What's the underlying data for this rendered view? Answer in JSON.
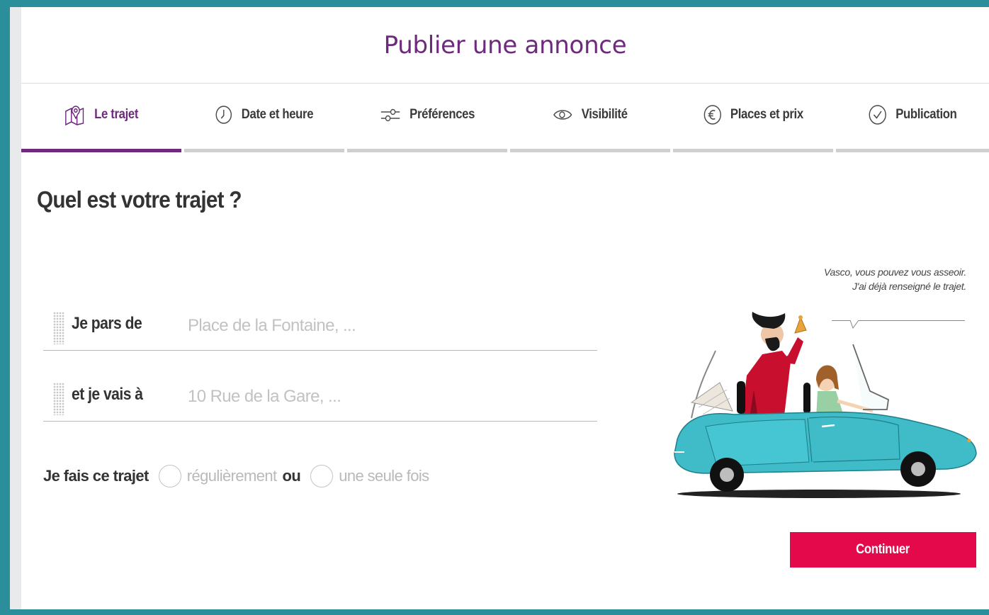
{
  "header": {
    "title": "Publier une annonce"
  },
  "steps": [
    {
      "label": "Le trajet",
      "icon": "map-pin-icon",
      "active": true
    },
    {
      "label": "Date et heure",
      "icon": "clock-icon",
      "active": false
    },
    {
      "label": "Préférences",
      "icon": "sliders-icon",
      "active": false
    },
    {
      "label": "Visibilité",
      "icon": "eye-icon",
      "active": false
    },
    {
      "label": "Places et prix",
      "icon": "euro-icon",
      "active": false
    },
    {
      "label": "Publication",
      "icon": "check-circle-icon",
      "active": false
    }
  ],
  "question": "Quel est votre trajet ?",
  "from": {
    "label": "Je pars de",
    "placeholder": "Place de la Fontaine, ...",
    "value": ""
  },
  "to": {
    "label": "et je vais à",
    "placeholder": "10 Rue de la Gare, ...",
    "value": ""
  },
  "frequency": {
    "label": "Je fais ce trajet",
    "option_regular": "régulièrement",
    "separator": "ou",
    "option_once": "une seule fois"
  },
  "illustration": {
    "speech_line1": "Vasco, vous pouvez vous asseoir.",
    "speech_line2": "J'ai déjà renseigné le trajet."
  },
  "continue_label": "Continuer",
  "colors": {
    "brand": "#6e2a7c",
    "cta": "#e3094a",
    "background": "#2b8f9b",
    "car": "#3fbcc8"
  }
}
